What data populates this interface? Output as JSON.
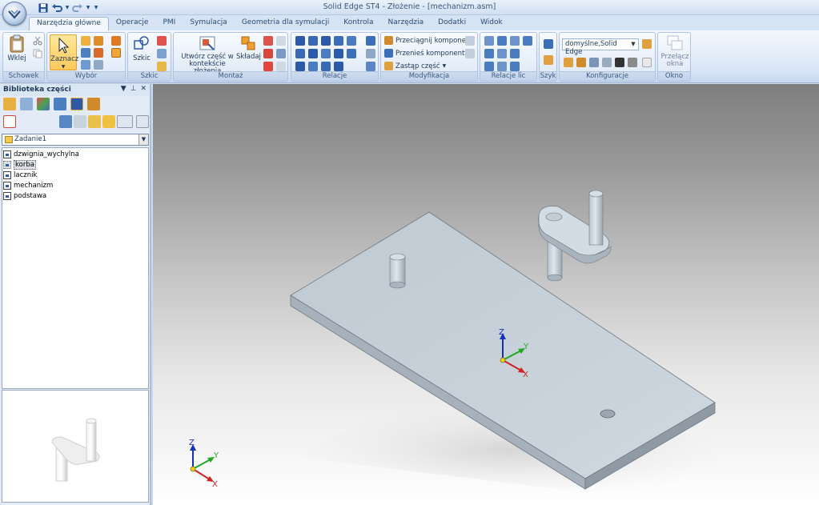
{
  "window": {
    "title": "Solid Edge ST4 - Złożenie - [mechanizm.asm]"
  },
  "quick_access": [
    "save-icon",
    "undo-icon",
    "redo-icon",
    "customize-icon"
  ],
  "tabs": [
    {
      "label": "Narzędzia główne",
      "active": true
    },
    {
      "label": "Operacje"
    },
    {
      "label": "PMI"
    },
    {
      "label": "Symulacja"
    },
    {
      "label": "Geometria dla symulacji"
    },
    {
      "label": "Kontrola"
    },
    {
      "label": "Narzędzia"
    },
    {
      "label": "Dodatki"
    },
    {
      "label": "Widok"
    }
  ],
  "ribbon": {
    "groups": {
      "schowek": "Schowek",
      "wybor": "Wybór",
      "szkic": "Szkic",
      "montaz": "Montaż",
      "relacje": "Relacje",
      "modyfikacja": "Modyfikacja",
      "relacje_lic": "Relacje lic",
      "szyk": "Szyk",
      "konfiguracje": "Konfiguracje",
      "okno": "Okno"
    },
    "buttons": {
      "wklej": "Wklej",
      "zaznacz": "Zaznacz",
      "szkic": "Szkic",
      "utworz_1": "Utwórz część w",
      "utworz_2": "kontekście złożenia",
      "skladaj": "Składaj",
      "przeciagnij": "Przeciągnij komponent",
      "przenies": "Przenieś komponenty",
      "zastap": "Zastąp część",
      "przelacz_1": "Przełącz",
      "przelacz_2": "okna"
    },
    "config_combo": "domyślne,Solid Edge"
  },
  "panel": {
    "title": "Biblioteka części",
    "folder": "Zadanie1",
    "files": [
      "dzwignia_wychylna",
      "korba",
      "lacznik",
      "mechanizm",
      "podstawa"
    ],
    "selected_file": "korba"
  },
  "viewport": {
    "axes": {
      "x": "X",
      "y": "Y",
      "z": "Z"
    }
  },
  "colors": {
    "accent": "#ffc95b",
    "ribbon_bg": "#dae6f6",
    "part_face_top": "#c9d3dc",
    "part_face_side": "#a9b4bf"
  }
}
